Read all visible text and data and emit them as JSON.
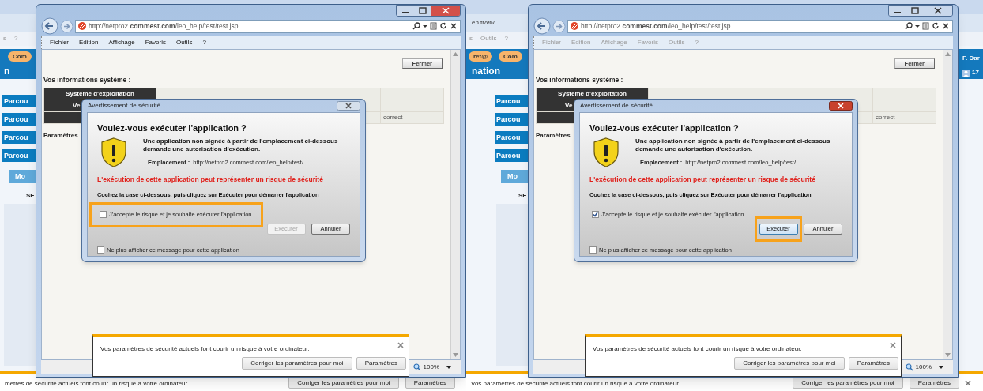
{
  "screens": [
    {
      "background": {
        "menu": [
          "s",
          "?"
        ],
        "tabs": [
          "Com"
        ],
        "heading": "n",
        "nav_items": [
          "Parcou",
          "Parcou",
          "Parcou",
          "Parcou"
        ],
        "section_tab": "Mo",
        "section_label": "SE",
        "notice": {
          "message": "mètres de sécurité actuels font courir un risque à votre ordinateur.",
          "buttons": [
            "Corriger les paramètres pour moi",
            "Paramètres"
          ]
        }
      },
      "browser": {
        "address": "http://netpro2.**commest.com**/leo_help/test/test.jsp",
        "active": true,
        "menu": [
          "Fichier",
          "Edition",
          "Affichage",
          "Favoris",
          "Outils",
          "?"
        ],
        "close_button": "Fermer",
        "info_title": "Vos informations système :",
        "table": [
          {
            "header": "Système d'exploitation"
          },
          {
            "header": "Ve"
          },
          {
            "value": "correct"
          }
        ],
        "section_title": "Paramètres",
        "zoom": "100%"
      },
      "dialog": {
        "title": "Avertissement de sécurité",
        "active": false,
        "heading": "Voulez-vous exécuter l'application ?",
        "message": "Une application non signée à partir de l'emplacement ci-dessous demande une autorisation d'exécution.",
        "location_label": "Emplacement :",
        "location": "http://netpro2.commest.com/leo_help/test/",
        "warning": "L'exécution de cette application peut représenter un risque de sécurité",
        "instruction": "Cochez la case ci-dessous, puis cliquez sur Exécuter pour démarrer l'application",
        "accept": {
          "label": "J'accepte le risque et je souhaite exécuter l'application.",
          "checked": false,
          "highlighted": true
        },
        "run_button": {
          "label": "Exécuter",
          "disabled": true,
          "highlighted": false
        },
        "cancel_button": "Annuler",
        "dont_show": {
          "label": "Ne plus afficher ce message pour cette application",
          "checked": false
        }
      },
      "notification": {
        "message": "Vos paramètres de sécurité actuels font courir un risque à votre ordinateur.",
        "buttons": [
          "Corriger les paramètres pour moi",
          "Paramètres"
        ]
      }
    },
    {
      "background": {
        "address": "en.fr/v6/",
        "menu": [
          "s",
          "Outils",
          "?"
        ],
        "tabs": [
          "ret@",
          "Com"
        ],
        "heading": "nation",
        "nav_items": [
          "Parcou",
          "Parcou",
          "Parcou",
          "Parcou"
        ],
        "section_tab": "Mo",
        "section_label": "SE",
        "user": "F. Dar",
        "count": "17",
        "notice": {
          "message": "Vos paramètres de sécurité actuels font courir un risque à votre ordinateur.",
          "buttons": [
            "Corriger les paramètres pour moi",
            "Paramètres"
          ],
          "closable": true
        }
      },
      "browser": {
        "address": "http://netpro2.**commest.com**/leo_help/test/test.jsp",
        "active": false,
        "menu": [
          "Fichier",
          "Edition",
          "Affichage",
          "Favoris",
          "Outils",
          "?"
        ],
        "close_button": "Fermer",
        "info_title": "Vos informations système :",
        "table": [
          {
            "header": "Système d'exploitation"
          },
          {
            "header": "Ve"
          },
          {
            "value": "correct"
          }
        ],
        "section_title": "Paramètres",
        "zoom": "100%"
      },
      "dialog": {
        "title": "Avertissement de sécurité",
        "active": true,
        "heading": "Voulez-vous exécuter l'application ?",
        "message": "Une application non signée à partir de l'emplacement ci-dessous demande une autorisation d'exécution.",
        "location_label": "Emplacement :",
        "location": "http://netpro2.commest.com/leo_help/test/",
        "warning": "L'exécution de cette application peut représenter un risque de sécurité",
        "instruction": "Cochez la case ci-dessous, puis cliquez sur Exécuter pour démarrer l'application",
        "accept": {
          "label": "J'accepte le risque et je souhaite exécuter l'application.",
          "checked": true,
          "highlighted": false
        },
        "run_button": {
          "label": "Exécuter",
          "disabled": false,
          "highlighted": true
        },
        "cancel_button": "Annuler",
        "dont_show": {
          "label": "Ne plus afficher ce message pour cette application",
          "checked": false
        }
      },
      "notification": {
        "message": "Vos paramètres de sécurité actuels font courir un risque à votre ordinateur.",
        "buttons": [
          "Corriger les paramètres pour moi",
          "Paramètres"
        ]
      }
    }
  ]
}
